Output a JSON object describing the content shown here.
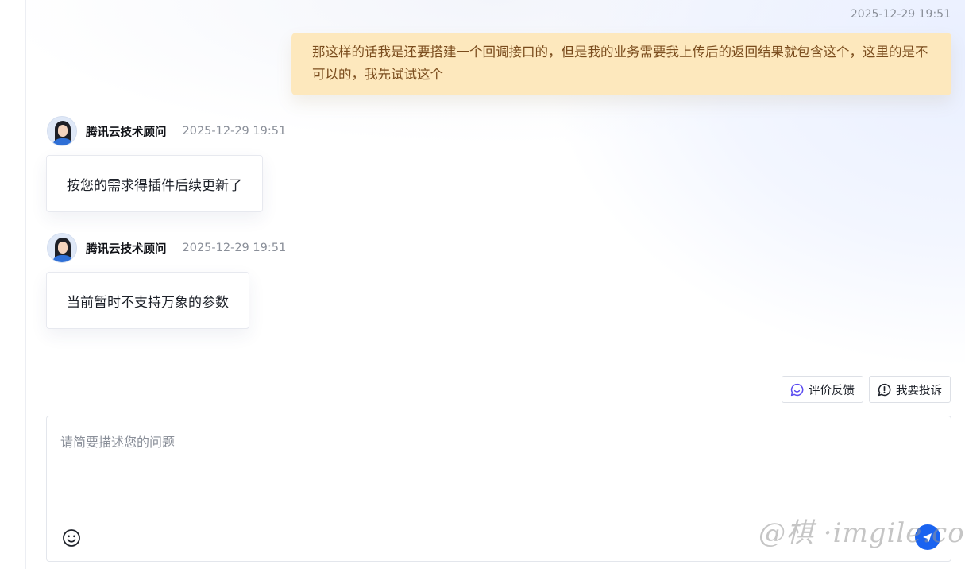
{
  "conversation": {
    "user_message": {
      "time": "2025-12-29 19:51",
      "text": "那这样的话我是还要搭建一个回调接口的，但是我的业务需要我上传后的返回结果就包含这个，这里的是不可以的，我先试试这个"
    },
    "agent_messages": [
      {
        "name": "腾讯云技术顾问",
        "time": "2025-12-29 19:51",
        "text": "按您的需求得插件后续更新了"
      },
      {
        "name": "腾讯云技术顾问",
        "time": "2025-12-29 19:51",
        "text": "当前暂时不支持万象的参数"
      }
    ]
  },
  "actions": {
    "feedback_label": "评价反馈",
    "complaint_label": "我要投诉"
  },
  "composer": {
    "placeholder": "请简要描述您的问题",
    "value": ""
  },
  "watermark": "@棋 ·imgile.com",
  "icons": {
    "feedback": "chat-bubble-icon",
    "complaint": "exclamation-circle-icon",
    "emoji": "smiley-icon",
    "send": "send-icon",
    "avatar": "agent-avatar"
  },
  "colors": {
    "user_bubble_bg": "#fde8bd",
    "user_bubble_text": "#7a4c1d",
    "feedback_icon": "#5b4cf0",
    "send_button": "#1a63f0",
    "timestamp": "#8a8f99"
  }
}
